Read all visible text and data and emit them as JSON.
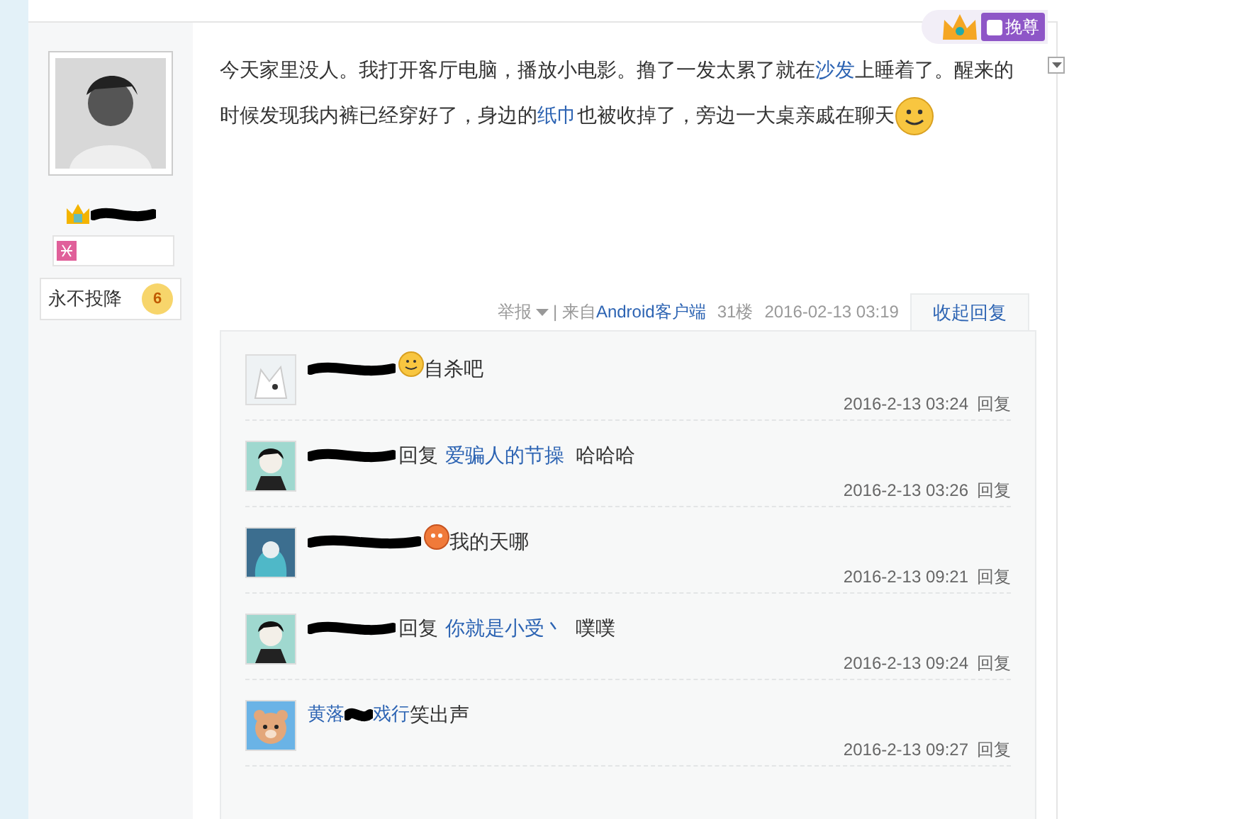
{
  "post": {
    "segments": [
      {
        "text": "今天家里没人。我打开客厅电脑，播放小电影。撸了一发太累了就在",
        "link": false
      },
      {
        "text": "沙发",
        "link": true
      },
      {
        "text": "上睡着了。醒来的时候发现我内裤已经穿好了，身边的",
        "link": false
      },
      {
        "text": "纸巾",
        "link": true
      },
      {
        "text": "也被收掉了，旁边一大桌亲戚在聊天",
        "link": false
      }
    ],
    "badge": "挽尊",
    "tail": {
      "report": "举报",
      "source_prefix": "| 来自",
      "source": "Android客户端",
      "floor": "31楼",
      "time": "2016-02-13 03:19",
      "collapse": "收起回复"
    }
  },
  "author": {
    "sign_label": "永不投降",
    "level": "6"
  },
  "replies": [
    {
      "avatar": {
        "kind": "fox"
      },
      "emoji": {
        "kind": "smile"
      },
      "text": "自杀吧",
      "time": "2016-2-13 03:24",
      "action": "回复"
    },
    {
      "avatar": {
        "kind": "boy"
      },
      "reply_word": "回复",
      "reply_to": "爱骗人的节操",
      "text": "哈哈哈",
      "time": "2016-2-13 03:26",
      "action": "回复"
    },
    {
      "avatar": {
        "kind": "girl"
      },
      "emoji": {
        "kind": "orange"
      },
      "text": "我的天哪",
      "time": "2016-2-13 09:21",
      "action": "回复"
    },
    {
      "avatar": {
        "kind": "boy"
      },
      "reply_word": "回复",
      "reply_to": "你就是小受丶",
      "text": "噗噗",
      "time": "2016-2-13 09:24",
      "action": "回复"
    },
    {
      "avatar": {
        "kind": "bear"
      },
      "name": "黄落",
      "name_tail": "戏行",
      "text": "笑出声",
      "time": "2016-2-13 09:27",
      "action": "回复"
    }
  ]
}
